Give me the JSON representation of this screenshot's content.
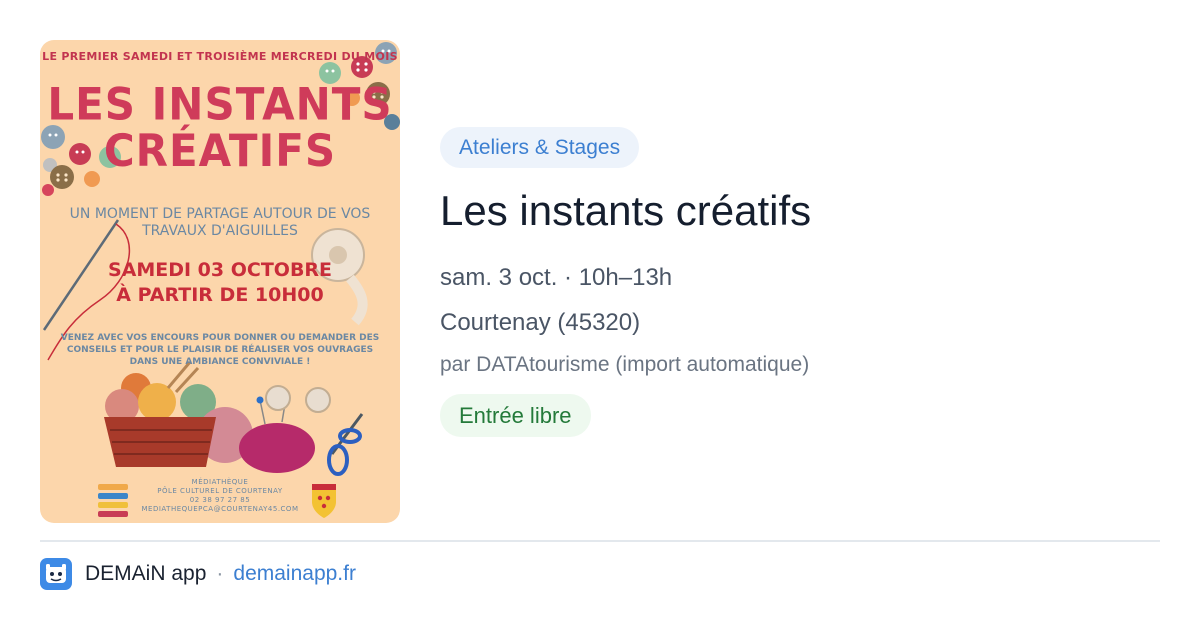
{
  "poster": {
    "top_line": "LE PREMIER SAMEDI ET TROISIÈME MERCREDI DU MOIS",
    "title_line1": "LES INSTANTS",
    "title_line2": "CRÉATIFS",
    "subtitle": "UN MOMENT DE PARTAGE AUTOUR DE VOS TRAVAUX D'AIGUILLES",
    "date_line1": "SAMEDI 03 OCTOBRE",
    "date_line2": "À PARTIR DE 10H00",
    "body": "VENEZ AVEC VOS ENCOURS POUR DONNER OU DEMANDER DES CONSEILS ET POUR LE PLAISIR DE RÉALISER VOS OUVRAGES DANS UNE AMBIANCE CONVIVIALE !",
    "footer_line1": "MÉDIATHÈQUE",
    "footer_line2": "PÔLE CULTUREL DE COURTENAY",
    "footer_line3": "02 38 97 27 85",
    "footer_line4": "MEDIATHEQUEPCA@COURTENAY45.COM"
  },
  "event": {
    "category": "Ateliers & Stages",
    "title": "Les instants créatifs",
    "when": "sam. 3 oct. · 10h–13h",
    "where": "Courtenay (45320)",
    "source": "par DATAtourisme (import automatique)",
    "price": "Entrée libre"
  },
  "footer": {
    "app_name": "DEMAiN app",
    "separator": "·",
    "link": "demainapp.fr"
  },
  "colors": {
    "accent": "#3c7fd1",
    "badge_bg": "#edf3fb",
    "price_text": "#247a3a",
    "price_bg": "#eef9ef",
    "poster_bg": "#fcd6ab",
    "poster_title": "#cf3b5a"
  },
  "icons": [
    "button-icon",
    "needle-icon",
    "tape-measure-icon",
    "yarn-basket-icon",
    "pincushion-icon",
    "scissors-icon",
    "books-icon",
    "coat-of-arms-icon",
    "app-logo-icon"
  ]
}
